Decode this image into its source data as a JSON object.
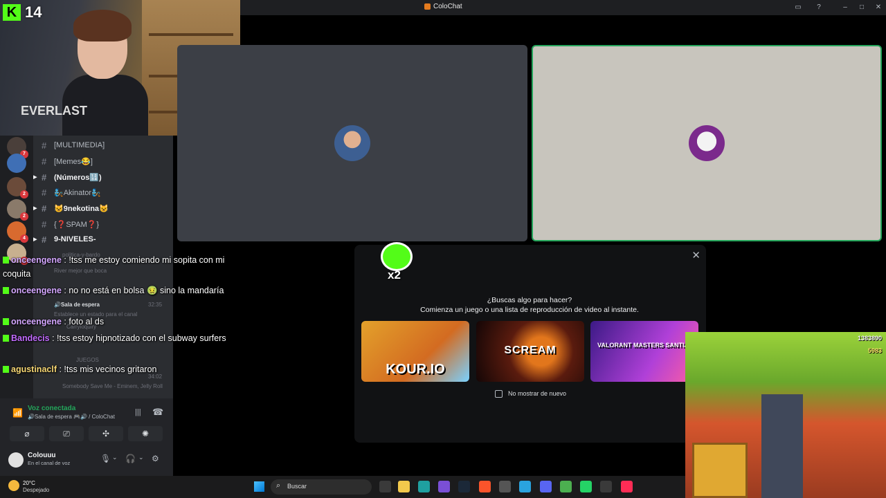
{
  "window": {
    "title": "ColoChat"
  },
  "webcam": {
    "kick_count": "14",
    "hoodie_text": "EVERLAST"
  },
  "rail_badges": [
    "7",
    "2",
    "2",
    "4",
    "2"
  ],
  "channels": [
    {
      "name": "[MULTIMEDIA]",
      "unread": false
    },
    {
      "name": "[Memes😂]",
      "unread": false
    },
    {
      "name": "(Números🔢)",
      "unread": true
    },
    {
      "name": "🧞Akinator🧞",
      "unread": false
    },
    {
      "name": "😺9nekotina😺",
      "unread": true
    },
    {
      "name": "{❓SPAM❓}",
      "unread": false
    },
    {
      "name": "9-NIVELES-",
      "unread": true
    }
  ],
  "faded": {
    "politica": "politica-y-bardo",
    "river": "River mejor que boca",
    "sala": "🔊Sala de espera",
    "sala_time": "32:35",
    "estado": "Establece un estado para el canal",
    "carry": "Carryloquiry",
    "juegos": "JUEGOS",
    "juegos_time": "34:02",
    "song": "Somebody Save Me - Eminem, Jelly Roll"
  },
  "chat": [
    {
      "user": "onceengene",
      "color": "#d3a6ff",
      "text": " : !tss me estoy comiendo mi sopita con mi coquita"
    },
    {
      "user": "onceengene",
      "color": "#d3a6ff",
      "text": " : no no está en bolsa 🤢 sino la mandaría"
    },
    {
      "user": "onceengene",
      "color": "#d3a6ff",
      "text": " : foto al ds"
    },
    {
      "user": "Bandecis",
      "color": "#c26bff",
      "text": " : !tss estoy hipnotizado con el subway surfers"
    },
    {
      "user": "agustinaclf",
      "color": "#f7d774",
      "text": " : !tss mis vecinos gritaron"
    }
  ],
  "voice": {
    "status": "Voz conectada",
    "channel": "🔊Sala de espera 🎮🔊 / ColoChat",
    "username": "Colouuu",
    "user_status": "En el canal de voz"
  },
  "popup": {
    "question": "¿Buscas algo para hacer?",
    "subtitle": "Comienza un juego o una lista de reproducción de video al instante.",
    "cards": [
      "KOUR.IO",
      "SCREAM",
      "VALORANT MASTERS SANTIAGO"
    ],
    "checkbox_label": "No mostrar de nuevo"
  },
  "mascot": {
    "label": "x2"
  },
  "subway": {
    "score": "1383890",
    "coins": "5983"
  },
  "taskbar": {
    "temp": "20°C",
    "condition": "Despejado",
    "search_placeholder": "Buscar"
  },
  "colors": {
    "kick_green": "#53fc18",
    "voice_green": "#23a55a",
    "discord_dark": "#2b2d31"
  }
}
